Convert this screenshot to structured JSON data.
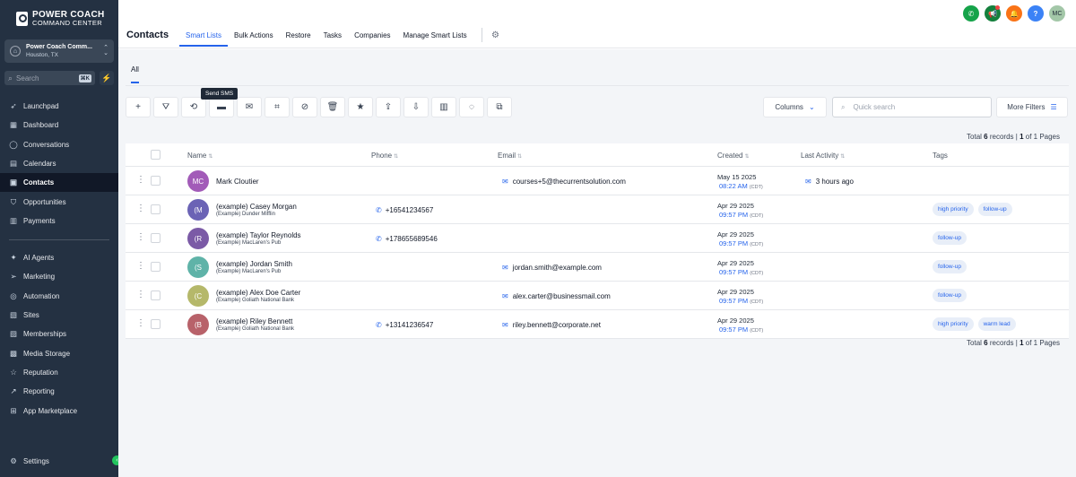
{
  "brand": {
    "title": "POWER COACH",
    "subtitle": "COMMAND CENTER"
  },
  "location": {
    "name": "Power Coach Comm...",
    "city": "Houston, TX"
  },
  "search": {
    "placeholder": "Search",
    "shortcut": "⌘K"
  },
  "sidebar": {
    "items": [
      {
        "label": "Launchpad",
        "icon": "rocket-icon"
      },
      {
        "label": "Dashboard",
        "icon": "grid-icon"
      },
      {
        "label": "Conversations",
        "icon": "chat-icon"
      },
      {
        "label": "Calendars",
        "icon": "calendar-icon"
      },
      {
        "label": "Contacts",
        "icon": "contacts-icon",
        "active": true
      },
      {
        "label": "Opportunities",
        "icon": "funnel-icon"
      },
      {
        "label": "Payments",
        "icon": "payments-icon"
      }
    ],
    "items2": [
      {
        "label": "AI Agents",
        "icon": "sparkle-icon"
      },
      {
        "label": "Marketing",
        "icon": "send-icon"
      },
      {
        "label": "Automation",
        "icon": "automation-icon"
      },
      {
        "label": "Sites",
        "icon": "sites-icon"
      },
      {
        "label": "Memberships",
        "icon": "memberships-icon"
      },
      {
        "label": "Media Storage",
        "icon": "media-icon"
      },
      {
        "label": "Reputation",
        "icon": "star-icon"
      },
      {
        "label": "Reporting",
        "icon": "chart-icon"
      },
      {
        "label": "App Marketplace",
        "icon": "apps-icon"
      }
    ],
    "settings": "Settings"
  },
  "header": {
    "title": "Contacts",
    "tabs": [
      "Smart Lists",
      "Bulk Actions",
      "Restore",
      "Tasks",
      "Companies",
      "Manage Smart Lists"
    ],
    "avatar": "MC"
  },
  "subtab": "All",
  "tooltip": "Send SMS",
  "toolbar": {
    "columns": "Columns",
    "quick_search_placeholder": "Quick search",
    "more_filters": "More Filters"
  },
  "pagination": {
    "prefix": "Total",
    "total": "6",
    "records": "records |",
    "page": "1",
    "of": "of 1 Pages"
  },
  "table": {
    "headers": [
      "Name",
      "Phone",
      "Email",
      "Created",
      "Last Activity",
      "Tags"
    ],
    "rows": [
      {
        "initials": "MC",
        "color": "#a25bb8",
        "name": "Mark Cloutier",
        "company": "",
        "phone": "",
        "email": "courses+5@thecurrentsolution.com",
        "date": "May 15 2025",
        "time": "08:22 AM",
        "tz": "(CDT)",
        "activity": "3 hours ago",
        "tags": []
      },
      {
        "initials": "(M",
        "color": "#6b63b5",
        "name": "(example) Casey Morgan",
        "company": "(Example) Dunder Mifflin",
        "phone": "+16541234567",
        "email": "",
        "date": "Apr 29 2025",
        "time": "09:57 PM",
        "tz": "(CDT)",
        "activity": "",
        "tags": [
          "high priority",
          "follow-up"
        ]
      },
      {
        "initials": "(R",
        "color": "#7b5aa6",
        "name": "(example) Taylor Reynolds",
        "company": "(Example) MacLaren's Pub",
        "phone": "+178655689546",
        "email": "",
        "date": "Apr 29 2025",
        "time": "09:57 PM",
        "tz": "(CDT)",
        "activity": "",
        "tags": [
          "follow-up"
        ]
      },
      {
        "initials": "(S",
        "color": "#5fb3a8",
        "name": "(example) Jordan Smith",
        "company": "(Example) MacLaren's Pub",
        "phone": "",
        "email": "jordan.smith@example.com",
        "date": "Apr 29 2025",
        "time": "09:57 PM",
        "tz": "(CDT)",
        "activity": "",
        "tags": [
          "follow-up"
        ]
      },
      {
        "initials": "(C",
        "color": "#b5b86a",
        "name": "(example) Alex Doe Carter",
        "company": "(Example) Goliath National Bank",
        "phone": "",
        "email": "alex.carter@businessmail.com",
        "date": "Apr 29 2025",
        "time": "09:57 PM",
        "tz": "(CDT)",
        "activity": "",
        "tags": [
          "follow-up"
        ]
      },
      {
        "initials": "(B",
        "color": "#b8626a",
        "name": "(example) Riley Bennett",
        "company": "(Example) Goliath National Bank",
        "phone": "+13141236547",
        "email": "riley.bennett@corporate.net",
        "date": "Apr 29 2025",
        "time": "09:57 PM",
        "tz": "(CDT)",
        "activity": "",
        "tags": [
          "high priority",
          "warm lead"
        ]
      }
    ]
  }
}
